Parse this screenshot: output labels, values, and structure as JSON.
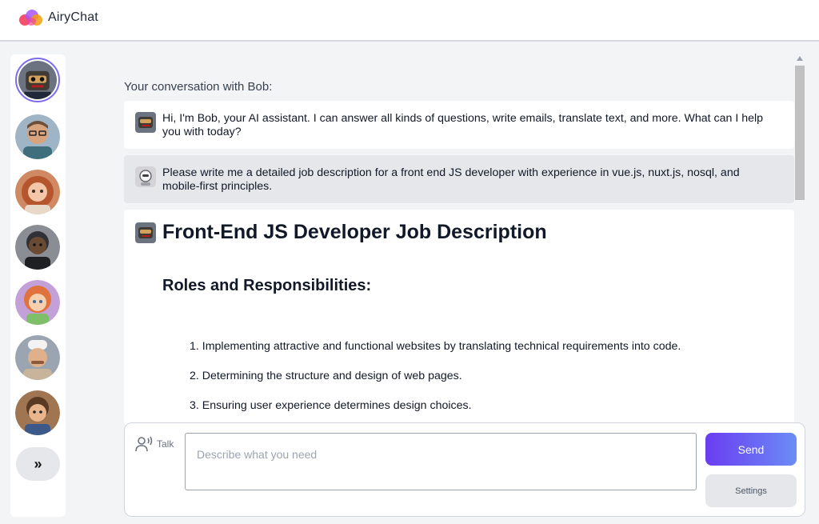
{
  "app": {
    "name": "AiryChat",
    "brand_colors": [
      "#f43f5e",
      "#a855f7",
      "#f59e0b"
    ]
  },
  "sidebar": {
    "avatars": [
      {
        "name": "Bob",
        "icon": "robot-avatar-icon",
        "active": true,
        "color": "#3f3a34"
      },
      {
        "name": "",
        "icon": "man-glasses-avatar-icon",
        "active": false,
        "color": "#5b6b7b"
      },
      {
        "name": "",
        "icon": "woman-red-hair-avatar-icon",
        "active": false,
        "color": "#b4552e"
      },
      {
        "name": "",
        "icon": "man-dark-avatar-icon",
        "active": false,
        "color": "#2f3136"
      },
      {
        "name": "",
        "icon": "girl-avatar-icon",
        "active": false,
        "color": "#e0723d"
      },
      {
        "name": "",
        "icon": "chef-avatar-icon",
        "active": false,
        "color": "#c7b49a"
      },
      {
        "name": "",
        "icon": "boy-avatar-icon",
        "active": false,
        "color": "#7b5132"
      }
    ],
    "expand_label": "»"
  },
  "conversation": {
    "title": "Your conversation with Bob:",
    "messages": [
      {
        "role": "bot",
        "text": "Hi, I'm Bob, your AI assistant. I can answer all kinds of questions, write emails, translate text, and more. What can I help you with today?"
      },
      {
        "role": "user",
        "text": "Please write me a detailed job description for a front end JS developer with experience in vue.js, nuxt.js, nosql, and mobile-first principles."
      }
    ],
    "answer": {
      "heading": "Front-End JS Developer Job Description",
      "subheading": "Roles and Responsibilities:",
      "items": [
        "1. Implementing attractive and functional websites by translating technical requirements into code.",
        "2. Determining the structure and design of web pages.",
        "3. Ensuring user experience determines design choices."
      ]
    }
  },
  "composer": {
    "talk_label": "Talk",
    "placeholder": "Describe what you need",
    "send_label": "Send",
    "settings_label": "Settings"
  }
}
